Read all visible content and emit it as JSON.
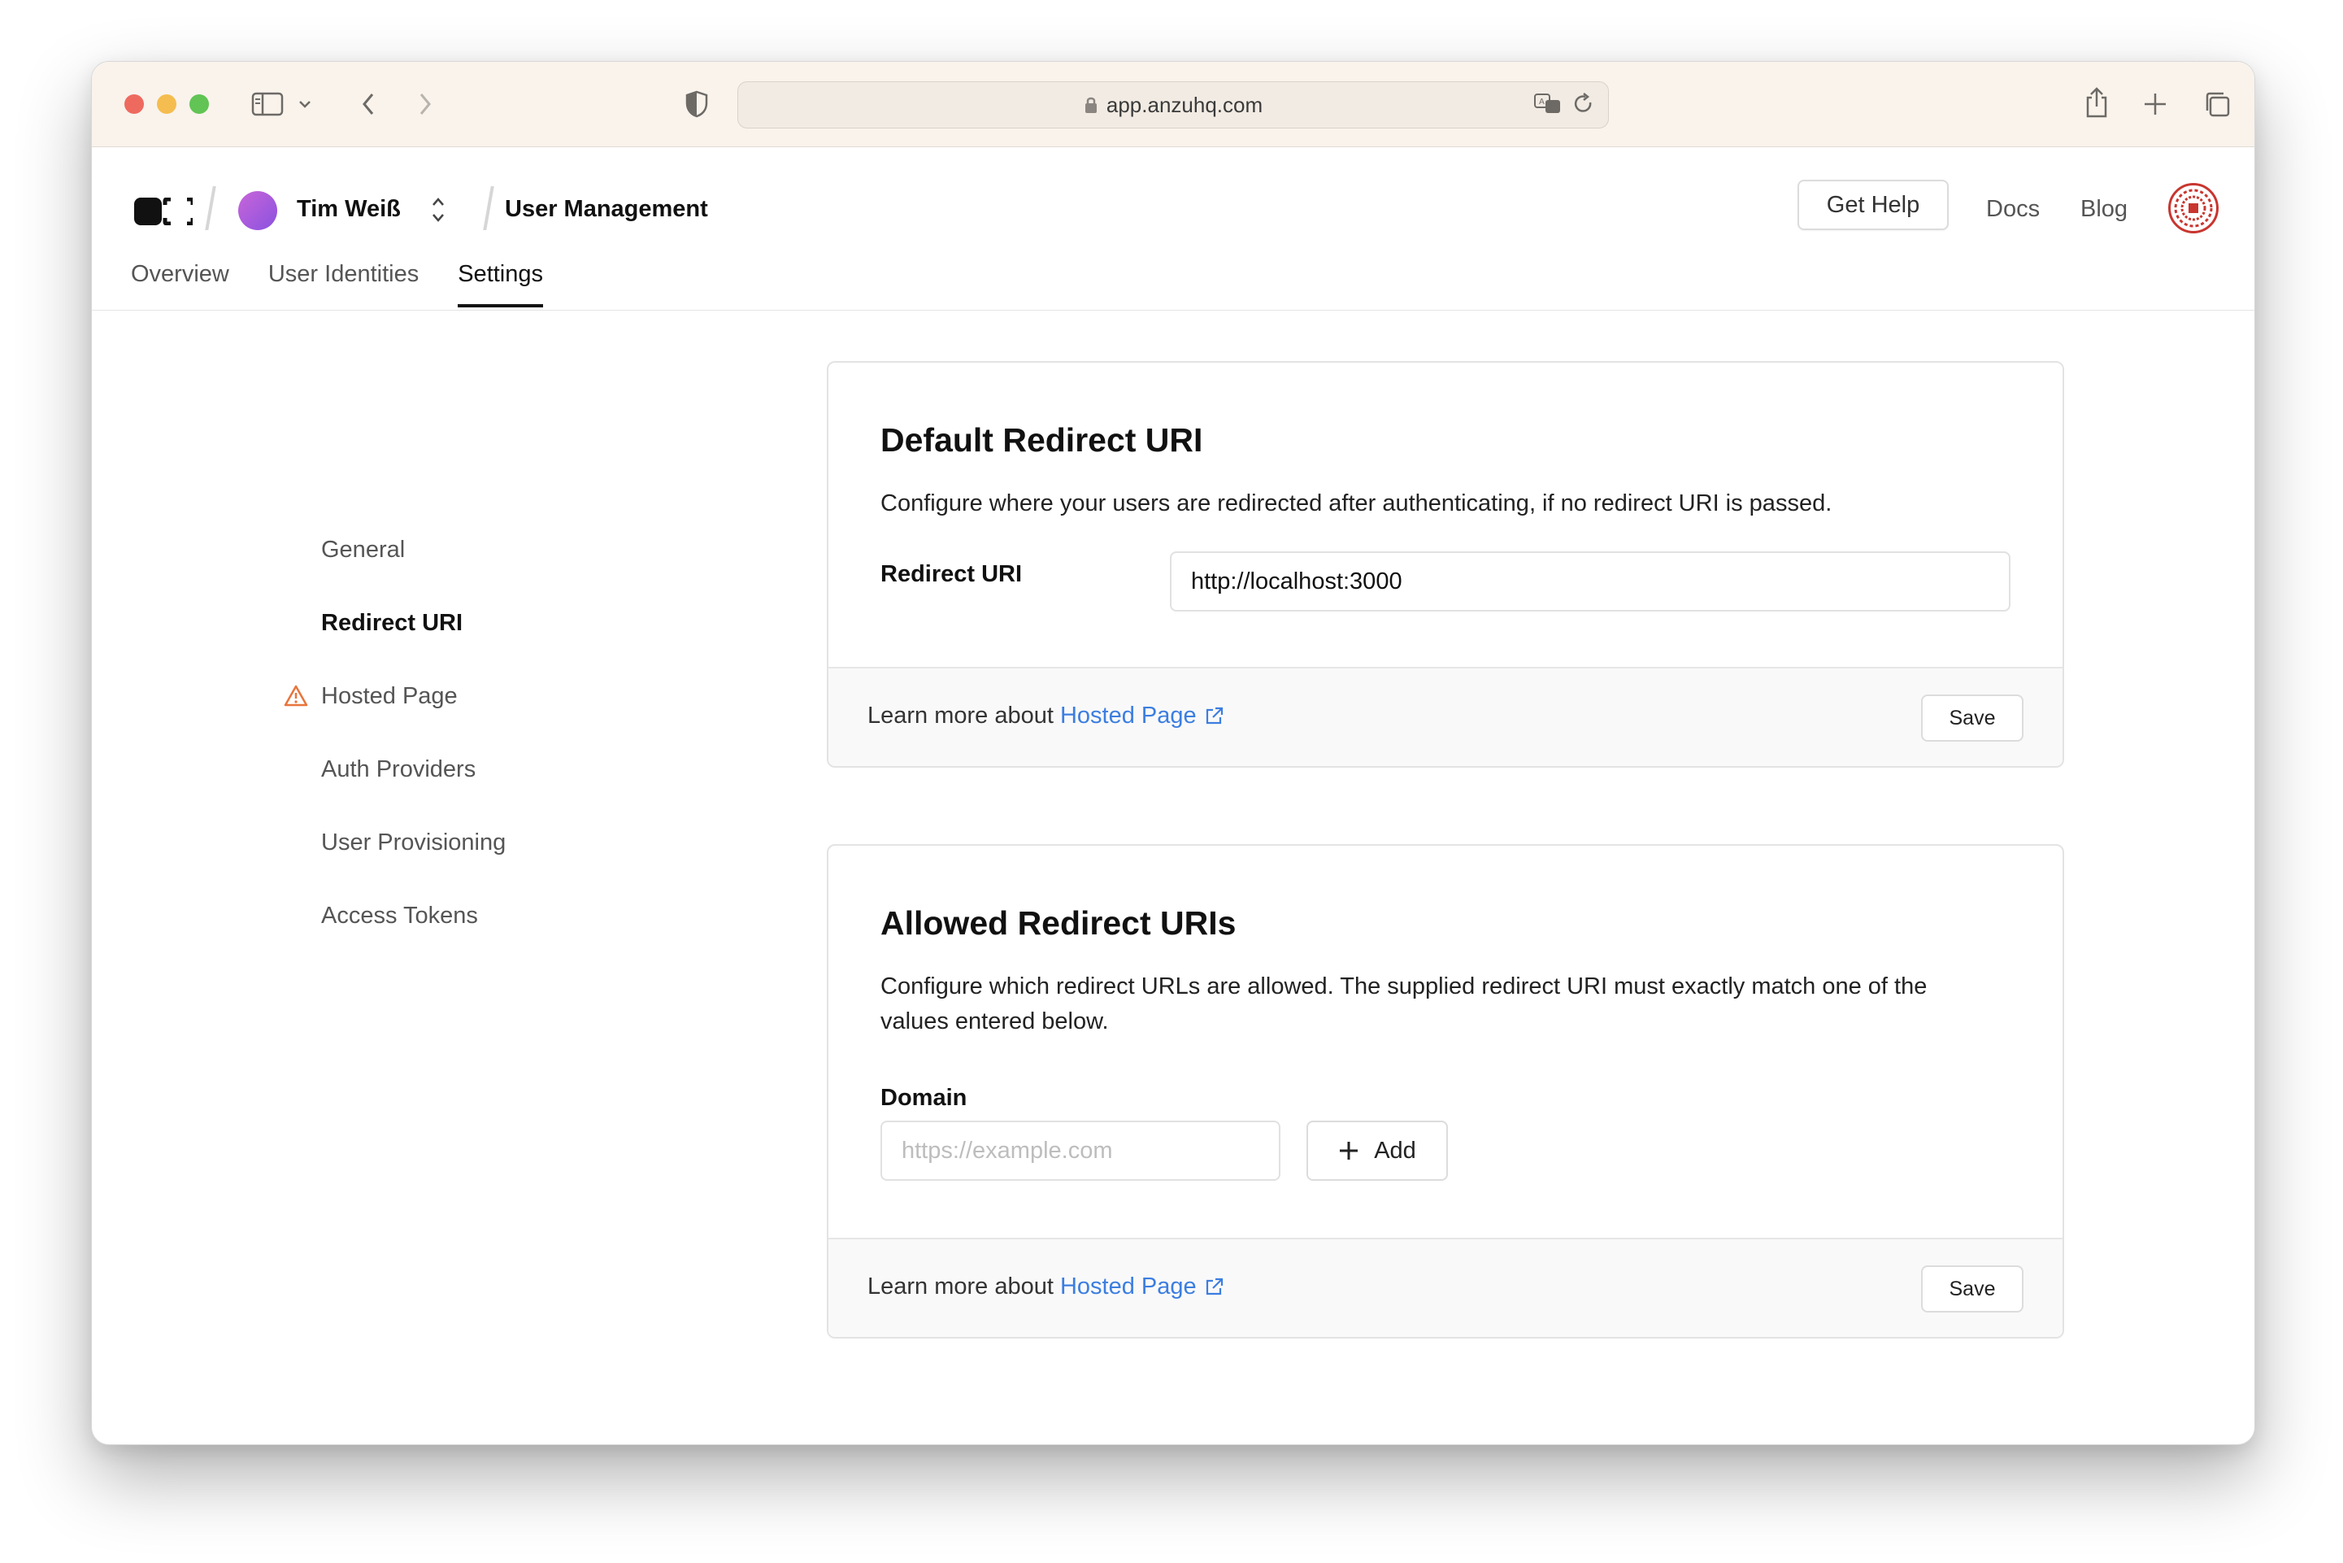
{
  "browser": {
    "url": "app.anzuhq.com"
  },
  "header": {
    "user_name": "Tim Weiß",
    "section": "User Management",
    "get_help": "Get Help",
    "docs": "Docs",
    "blog": "Blog"
  },
  "tabs": [
    {
      "label": "Overview"
    },
    {
      "label": "User Identities"
    },
    {
      "label": "Settings"
    }
  ],
  "active_tab": "Settings",
  "sidebar": {
    "items": [
      {
        "label": "General"
      },
      {
        "label": "Redirect URI"
      },
      {
        "label": "Hosted Page"
      },
      {
        "label": "Auth Providers"
      },
      {
        "label": "User Provisioning"
      },
      {
        "label": "Access Tokens"
      }
    ],
    "active": "Redirect URI",
    "warning_item": "Hosted Page"
  },
  "default_redirect": {
    "title": "Default Redirect URI",
    "description": "Configure where your users are redirected after authenticating, if no redirect URI is passed.",
    "field_label": "Redirect URI",
    "field_value": "http://localhost:3000",
    "footer_text": "Learn more about",
    "footer_link": "Hosted Page",
    "save_label": "Save"
  },
  "allowed_redirects": {
    "title": "Allowed Redirect URIs",
    "description": "Configure which redirect URLs are allowed. The supplied redirect URI must exactly match one of the values entered below.",
    "field_label": "Domain",
    "placeholder": "https://example.com",
    "add_label": "Add",
    "footer_text": "Learn more about",
    "footer_link": "Hosted Page",
    "save_label": "Save"
  },
  "colors": {
    "link": "#3c7ee0",
    "warning": "#e8743b",
    "avatar": "#a35ee0",
    "traffic_red": "#ee6a5f",
    "traffic_yellow": "#f5bd4f",
    "traffic_green": "#61c454"
  }
}
